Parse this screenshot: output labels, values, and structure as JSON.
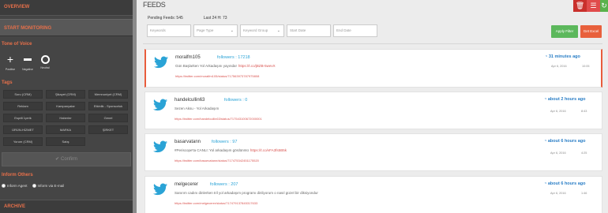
{
  "sidebar": {
    "overview": "OVERVIEW",
    "start_monitoring": "START MONITORING",
    "tone_title": "Tone of Voice",
    "tones": [
      {
        "icon": "plus-icon",
        "label": "Positive"
      },
      {
        "icon": "minus-icon",
        "label": "Negative"
      },
      {
        "icon": "circle-icon",
        "label": "Neutral"
      }
    ],
    "tags_title": "Tags",
    "tags": [
      "Soru (CRM)",
      "Şikayet (CRM)",
      "Memnuniyet (CRM)",
      "Reklam",
      "Kampanyalar",
      "Etkinlik - Sponsorluk",
      "Esprili İçerik",
      "Haberler",
      "Genel",
      "ÜRÜN-HİZMET",
      "MARKA",
      "ŞİRKET",
      "Yorum (CRM)",
      "Satış"
    ],
    "confirm_label": "Confirm",
    "inform_title": "Inform Others",
    "inform_options": [
      "Inform Agent",
      "Inform via E-mail"
    ],
    "archive": "ARCHIVE"
  },
  "main": {
    "title": "FEEDS",
    "pending_label": "Pending Feeds:",
    "pending_value": "545",
    "last24_label": "Last 24 H:",
    "last24_value": "73",
    "filters": [
      {
        "placeholder": "Keywords",
        "dropdown": false
      },
      {
        "placeholder": "Page Type",
        "dropdown": true
      },
      {
        "placeholder": "Keyword Group",
        "dropdown": true
      },
      {
        "placeholder": "Start Date",
        "dropdown": false
      },
      {
        "placeholder": "End Date",
        "dropdown": false
      }
    ],
    "apply_filter": "Apply Filter",
    "get_excel": "Get Excel",
    "icons": [
      "trash-icon",
      "list-icon",
      "refresh-icon"
    ],
    "colors": {
      "accent": "#e85c3c",
      "twitter": "#2aa3d6",
      "link": "#d9534f",
      "apply": "#5cb85c",
      "excel": "#e8603c"
    },
    "feeds": [
      {
        "user": "moralfm105",
        "followers": "followers : 17218",
        "text": "Gün Başlarken Yol Arkadaşını yayında!",
        "link": "https://t.co/jBZB-5wevX",
        "status_url": "https://twitter.com/moralfm105/status/717563973787975808",
        "ago": "31 minutes ago",
        "date": "Apr 6, 2016",
        "time": "10:05",
        "active": true
      },
      {
        "user": "handelcullin63",
        "followers": "followers : 0",
        "text": "Sezen Aksu - Yol Arkadaşım",
        "link": "",
        "status_url": "https://twitter.com/handelcullin63/status/717543100672000001",
        "ago": "about 2 hours ago",
        "date": "Apr 6, 2016",
        "time": "8:43",
        "active": false
      },
      {
        "user": "basarvatann",
        "followers": "followers : 97",
        "text": "#Periscope'ta CANLI: Yol arkadaşım gördünmü",
        "link": "https://t.co/vFA3fs5B5k",
        "status_url": "https://twitter.com/basarvatann/status/717475342451175520",
        "ago": "about 6 hours ago",
        "date": "Apr 6, 2016",
        "time": "4:25",
        "active": false
      },
      {
        "user": "melgecerer",
        "followers": "followers : 207",
        "text": "Sanırım cadını dinlerken tril yol arkadaşım programı dinliyorum o nasıl güzel bir diksiyondur",
        "link": "",
        "status_url": "https://twitter.com/melgecerer/status/717479137845317633",
        "ago": "about 6 hours ago",
        "date": "Apr 6, 2016",
        "time": "1:46",
        "active": false
      }
    ]
  }
}
